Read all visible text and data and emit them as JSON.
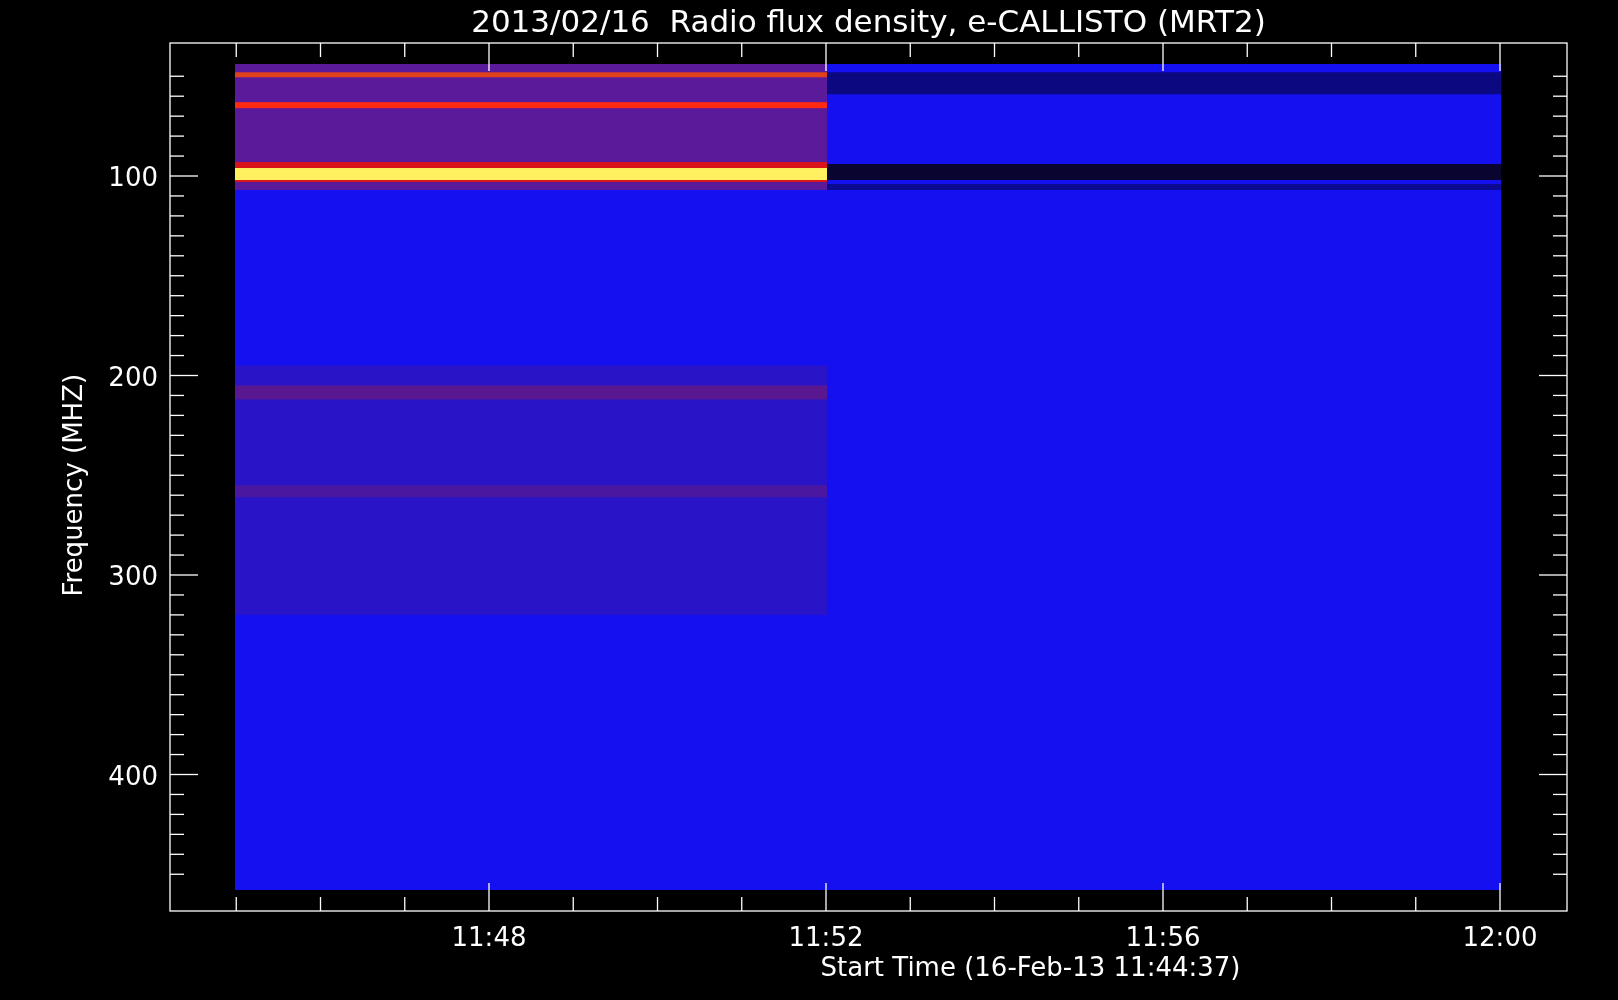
{
  "title": "2013/02/16  Radio flux density, e-CALLISTO (MRT2)",
  "y_axis": {
    "label": "Frequency (MHZ)",
    "ticks": [
      "100",
      "200",
      "300",
      "400"
    ]
  },
  "x_axis": {
    "label": "Start Time (16-Feb-13 11:44:37)",
    "ticks": [
      "11:48",
      "11:52",
      "11:56",
      "12:00"
    ]
  }
}
